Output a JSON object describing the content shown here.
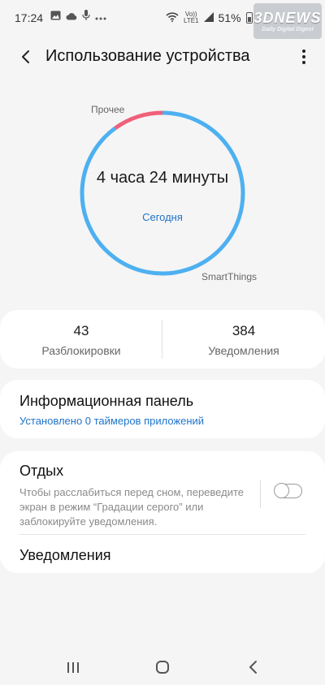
{
  "status_bar": {
    "time": "17:24",
    "icons": [
      "image-icon",
      "cloud-icon",
      "mic-icon",
      "more-icon"
    ],
    "network_label_top": "Vo))",
    "network_label_bottom": "LTE1",
    "battery": "51%"
  },
  "watermark": {
    "main": "3DNEWS",
    "sub": "Daily Digital Digest"
  },
  "header": {
    "title": "Использование устройства"
  },
  "usage": {
    "total": "4 часа 24 минуты",
    "period": "Сегодня",
    "segments": [
      {
        "label": "SmartThings",
        "fraction": 0.9,
        "color": "#4eb0f0"
      },
      {
        "label": "Прочее",
        "fraction": 0.1,
        "color": "#f0607a"
      }
    ]
  },
  "stats": {
    "unlocks": {
      "value": "43",
      "label": "Разблокировки"
    },
    "notifications": {
      "value": "384",
      "label": "Уведомления"
    }
  },
  "dashboard": {
    "title": "Информационная панель",
    "subtitle": "Установлено 0 таймеров приложений"
  },
  "wind_down": {
    "title": "Отдых",
    "description": "Чтобы расслабиться перед сном, переведите экран в режим “Градации серого” или заблокируйте уведомления.",
    "enabled": false
  },
  "notifications_row": {
    "title": "Уведомления"
  },
  "nav": {
    "recent": "recent-apps-icon",
    "home": "home-icon",
    "back": "back-icon"
  }
}
